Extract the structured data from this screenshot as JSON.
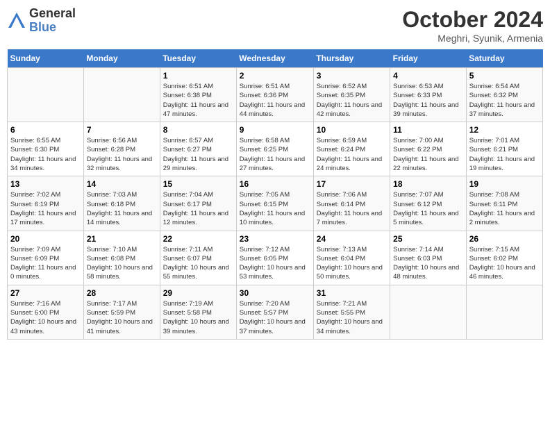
{
  "header": {
    "logo_general": "General",
    "logo_blue": "Blue",
    "month_title": "October 2024",
    "location": "Meghri, Syunik, Armenia"
  },
  "days_of_week": [
    "Sunday",
    "Monday",
    "Tuesday",
    "Wednesday",
    "Thursday",
    "Friday",
    "Saturday"
  ],
  "weeks": [
    [
      {
        "day": "",
        "info": ""
      },
      {
        "day": "",
        "info": ""
      },
      {
        "day": "1",
        "info": "Sunrise: 6:51 AM\nSunset: 6:38 PM\nDaylight: 11 hours and 47 minutes."
      },
      {
        "day": "2",
        "info": "Sunrise: 6:51 AM\nSunset: 6:36 PM\nDaylight: 11 hours and 44 minutes."
      },
      {
        "day": "3",
        "info": "Sunrise: 6:52 AM\nSunset: 6:35 PM\nDaylight: 11 hours and 42 minutes."
      },
      {
        "day": "4",
        "info": "Sunrise: 6:53 AM\nSunset: 6:33 PM\nDaylight: 11 hours and 39 minutes."
      },
      {
        "day": "5",
        "info": "Sunrise: 6:54 AM\nSunset: 6:32 PM\nDaylight: 11 hours and 37 minutes."
      }
    ],
    [
      {
        "day": "6",
        "info": "Sunrise: 6:55 AM\nSunset: 6:30 PM\nDaylight: 11 hours and 34 minutes."
      },
      {
        "day": "7",
        "info": "Sunrise: 6:56 AM\nSunset: 6:28 PM\nDaylight: 11 hours and 32 minutes."
      },
      {
        "day": "8",
        "info": "Sunrise: 6:57 AM\nSunset: 6:27 PM\nDaylight: 11 hours and 29 minutes."
      },
      {
        "day": "9",
        "info": "Sunrise: 6:58 AM\nSunset: 6:25 PM\nDaylight: 11 hours and 27 minutes."
      },
      {
        "day": "10",
        "info": "Sunrise: 6:59 AM\nSunset: 6:24 PM\nDaylight: 11 hours and 24 minutes."
      },
      {
        "day": "11",
        "info": "Sunrise: 7:00 AM\nSunset: 6:22 PM\nDaylight: 11 hours and 22 minutes."
      },
      {
        "day": "12",
        "info": "Sunrise: 7:01 AM\nSunset: 6:21 PM\nDaylight: 11 hours and 19 minutes."
      }
    ],
    [
      {
        "day": "13",
        "info": "Sunrise: 7:02 AM\nSunset: 6:19 PM\nDaylight: 11 hours and 17 minutes."
      },
      {
        "day": "14",
        "info": "Sunrise: 7:03 AM\nSunset: 6:18 PM\nDaylight: 11 hours and 14 minutes."
      },
      {
        "day": "15",
        "info": "Sunrise: 7:04 AM\nSunset: 6:17 PM\nDaylight: 11 hours and 12 minutes."
      },
      {
        "day": "16",
        "info": "Sunrise: 7:05 AM\nSunset: 6:15 PM\nDaylight: 11 hours and 10 minutes."
      },
      {
        "day": "17",
        "info": "Sunrise: 7:06 AM\nSunset: 6:14 PM\nDaylight: 11 hours and 7 minutes."
      },
      {
        "day": "18",
        "info": "Sunrise: 7:07 AM\nSunset: 6:12 PM\nDaylight: 11 hours and 5 minutes."
      },
      {
        "day": "19",
        "info": "Sunrise: 7:08 AM\nSunset: 6:11 PM\nDaylight: 11 hours and 2 minutes."
      }
    ],
    [
      {
        "day": "20",
        "info": "Sunrise: 7:09 AM\nSunset: 6:09 PM\nDaylight: 11 hours and 0 minutes."
      },
      {
        "day": "21",
        "info": "Sunrise: 7:10 AM\nSunset: 6:08 PM\nDaylight: 10 hours and 58 minutes."
      },
      {
        "day": "22",
        "info": "Sunrise: 7:11 AM\nSunset: 6:07 PM\nDaylight: 10 hours and 55 minutes."
      },
      {
        "day": "23",
        "info": "Sunrise: 7:12 AM\nSunset: 6:05 PM\nDaylight: 10 hours and 53 minutes."
      },
      {
        "day": "24",
        "info": "Sunrise: 7:13 AM\nSunset: 6:04 PM\nDaylight: 10 hours and 50 minutes."
      },
      {
        "day": "25",
        "info": "Sunrise: 7:14 AM\nSunset: 6:03 PM\nDaylight: 10 hours and 48 minutes."
      },
      {
        "day": "26",
        "info": "Sunrise: 7:15 AM\nSunset: 6:02 PM\nDaylight: 10 hours and 46 minutes."
      }
    ],
    [
      {
        "day": "27",
        "info": "Sunrise: 7:16 AM\nSunset: 6:00 PM\nDaylight: 10 hours and 43 minutes."
      },
      {
        "day": "28",
        "info": "Sunrise: 7:17 AM\nSunset: 5:59 PM\nDaylight: 10 hours and 41 minutes."
      },
      {
        "day": "29",
        "info": "Sunrise: 7:19 AM\nSunset: 5:58 PM\nDaylight: 10 hours and 39 minutes."
      },
      {
        "day": "30",
        "info": "Sunrise: 7:20 AM\nSunset: 5:57 PM\nDaylight: 10 hours and 37 minutes."
      },
      {
        "day": "31",
        "info": "Sunrise: 7:21 AM\nSunset: 5:55 PM\nDaylight: 10 hours and 34 minutes."
      },
      {
        "day": "",
        "info": ""
      },
      {
        "day": "",
        "info": ""
      }
    ]
  ]
}
